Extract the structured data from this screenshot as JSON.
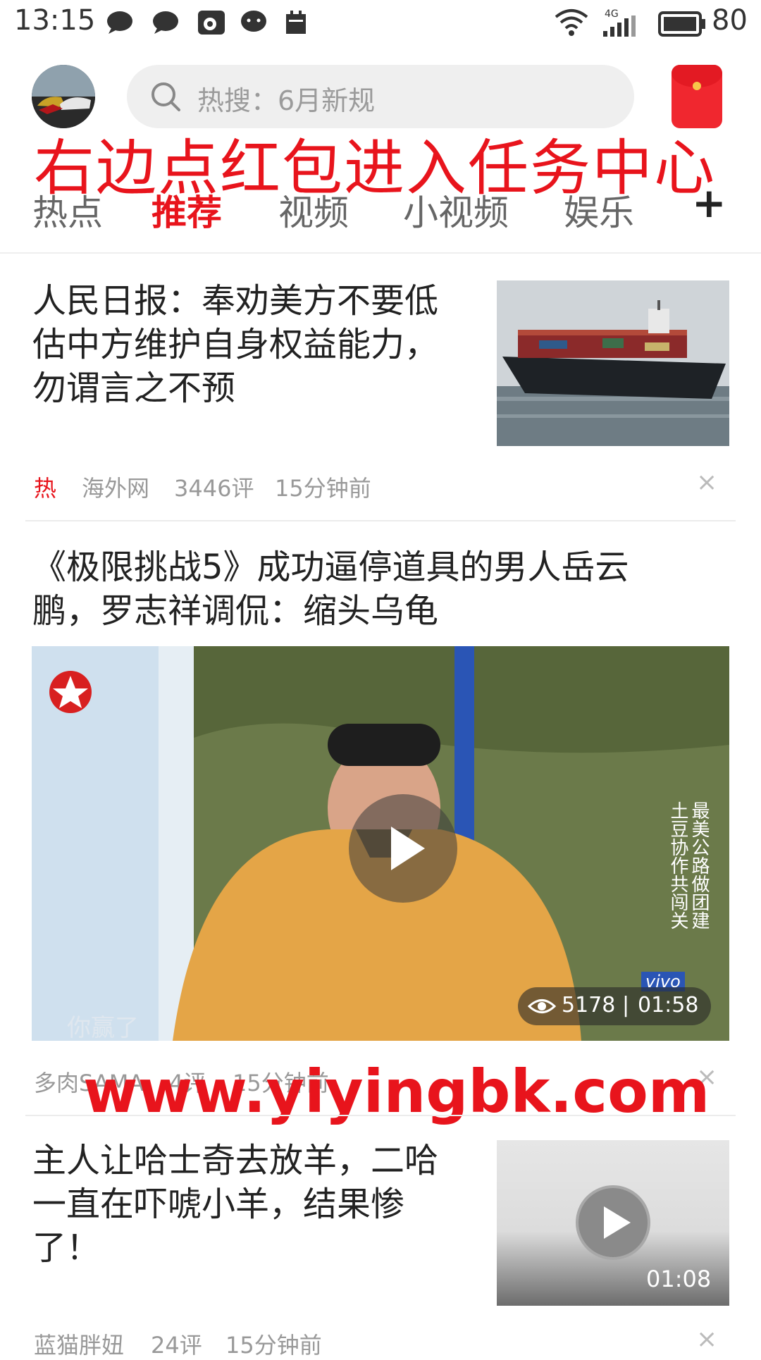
{
  "status_bar": {
    "time": "13:15",
    "battery": "80",
    "network": "4G"
  },
  "header": {
    "search_placeholder": "热搜：6月新规",
    "overlay_hint": "右边点红包进入任务中心"
  },
  "tabs": [
    {
      "label": "热点",
      "active": false
    },
    {
      "label": "推荐",
      "active": true
    },
    {
      "label": "视频",
      "active": false
    },
    {
      "label": "小视频",
      "active": false
    },
    {
      "label": "娱乐",
      "active": false
    }
  ],
  "tab_add": "+",
  "articles": [
    {
      "title_lines": [
        "人民日报：奉劝美方不要低",
        "估中方维护自身权益能力，",
        "勿谓言之不预"
      ],
      "hot_badge": "热",
      "source": "海外网",
      "comments": "3446评",
      "time": "15分钟前",
      "close": "×"
    },
    {
      "title_lines": [
        "《极限挑战5》成功逼停道具的男人岳云",
        "鹏，罗志祥调侃：缩头乌龟"
      ],
      "views": "5178",
      "duration": "01:58",
      "caption": "你赢了",
      "side_text": "最美公路做团建",
      "side_text2": "土豆协作共闯关",
      "brand": "vivo",
      "source": "多肉SAMA",
      "comments": "4评",
      "time": "15分钟前",
      "close": "×"
    },
    {
      "title_lines": [
        "主人让哈士奇去放羊，二哈",
        "一直在吓唬小羊，结果惨",
        "了！"
      ],
      "duration": "01:08",
      "source": "蓝猫胖妞",
      "comments": "24评",
      "time": "15分钟前",
      "close": "×"
    }
  ],
  "watermark": "www.yiyingbk.com",
  "colors": {
    "accent": "#e8141c",
    "meta": "#999999",
    "redpacket": "#f0272f"
  }
}
